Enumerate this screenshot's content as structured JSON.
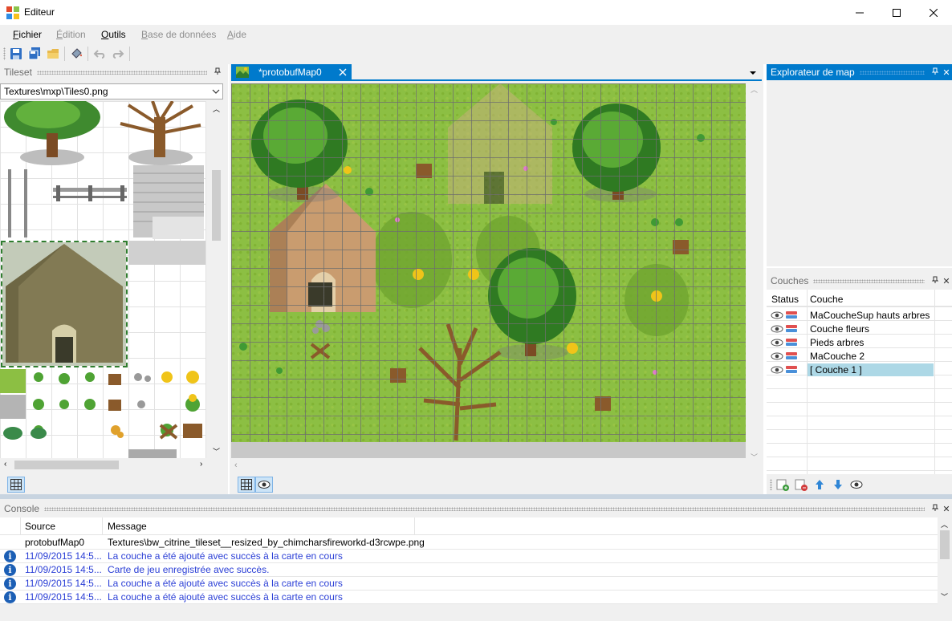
{
  "window": {
    "title": "Editeur",
    "minimize": "─",
    "maximize": "☐",
    "close": "✕"
  },
  "menu": {
    "fichier": {
      "u": "F",
      "rest": "ichier"
    },
    "edition": {
      "u": "É",
      "rest": "dition"
    },
    "outils": {
      "u": "O",
      "rest": "utils"
    },
    "base": {
      "u": "B",
      "rest": "ase de données"
    },
    "aide": {
      "u": "A",
      "rest": "ide"
    }
  },
  "tileset": {
    "title": "Tileset",
    "path": "Textures\\mxp\\Tiles0.png"
  },
  "document": {
    "tab": "*protobufMap0"
  },
  "explorer": {
    "title": "Explorateur de map"
  },
  "layers": {
    "title": "Couches",
    "col_status": "Status",
    "col_layer": "Couche",
    "rows": [
      {
        "name": "MaCoucheSup hauts arbres"
      },
      {
        "name": "Couche fleurs"
      },
      {
        "name": "Pieds arbres"
      },
      {
        "name": "MaCouche 2"
      },
      {
        "name": "[ Couche 1 ]"
      }
    ]
  },
  "console": {
    "title": "Console",
    "col_source": "Source",
    "col_message": "Message",
    "rows": [
      {
        "source": "protobufMap0",
        "message": "Textures\\bw_citrine_tileset__resized_by_chimcharsfireworkd-d3rcwpe.png"
      },
      {
        "source": "11/09/2015 14:5...",
        "message": "La couche a été ajouté avec succès à la carte en cours"
      },
      {
        "source": "11/09/2015 14:5...",
        "message": "Carte de jeu enregistrée avec succès."
      },
      {
        "source": "11/09/2015 14:5...",
        "message": "La couche a été ajouté avec succès à la carte en cours"
      },
      {
        "source": "11/09/2015 14:5...",
        "message": "La couche a été ajouté avec succès à la carte en cours"
      }
    ]
  },
  "icons": {
    "pin": "📌",
    "close": "✕",
    "dropdown": "⌄",
    "info": "i"
  },
  "colors": {
    "accent": "#007acc",
    "grass": "#8cbf43",
    "selected_row": "#add8e6",
    "info_text": "#2b3fd6"
  }
}
